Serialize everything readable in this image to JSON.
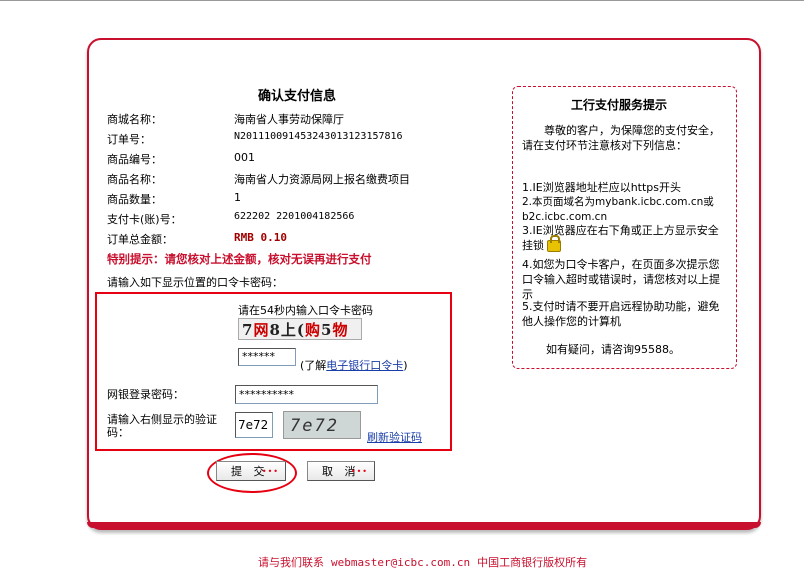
{
  "header": {
    "title": "确认支付信息"
  },
  "order": [
    {
      "label": "商城名称：",
      "value": "海南省人事劳动保障厅"
    },
    {
      "label": "订单号：",
      "value": "N20111009145324301312315781​6"
    },
    {
      "label": "商品编号：",
      "value": "001"
    },
    {
      "label": "商品名称：",
      "value": "海南省人力资源局网上报名缴费项目"
    },
    {
      "label": "商品数量：",
      "value": "1"
    },
    {
      "label": "支付卡(账)号：",
      "value": "622202 2201004182566"
    },
    {
      "label": "订单总金额：",
      "value": "RMB 0.10"
    }
  ],
  "warning": "特别提示：请您核对上述金额，核对无误再进行支付",
  "instruction": "请输入如下显示位置的口令卡密码：",
  "token": {
    "prompt": "请在54秒内输入口令卡密码",
    "captcha_text_a": "7",
    "captcha_text_b": "网",
    "captcha_text_c": "8上",
    "captcha_text_d": "(",
    "captcha_text_e": "购",
    "captcha_text_f": "5",
    "captcha_text_g": "物",
    "password_value": "******",
    "learn_prefix": "(了解",
    "learn_link": "电子银行口令卡",
    "learn_suffix": ")"
  },
  "login": {
    "label": "网银登录密码：",
    "password_value": "**********"
  },
  "verify": {
    "label": "请输入右侧显示的验证码：",
    "input_value": "7e72",
    "captcha_image_text": "7e72",
    "refresh_link": "刷新验证码"
  },
  "buttons": {
    "submit": "提 交",
    "cancel": "取 消",
    "dots": "•••"
  },
  "sidebar": {
    "title": "工行支付服务提示",
    "intro": "尊敬的客户，为保障您的支付安全，请在支付环节注意核对下列信息：",
    "tip1": "1.IE浏览器地址栏应以https开头",
    "tip2": "2.本页面域名为mybank.icbc.com.cn或b2c.icbc.com.cn",
    "tip3": "3.IE浏览器应在右下角或正上方显示安全挂锁",
    "tip4": "4.如您为口令卡客户，在页面多次提示您口令输入超时或错误时，请您核对以上提示",
    "tip5": "5.支付时请不要开启远程协助功能，避免他人操作您的计算机",
    "contact": "如有疑问，请咨询95588。"
  },
  "footer": {
    "contact": "请与我们联系",
    "email": "webmaster@icbc.com.cn",
    "copyright": "中国工商银行版权所有"
  },
  "colors": {
    "accent": "#c8102e",
    "highlight": "#e60012",
    "link": "#1a3ea8"
  }
}
